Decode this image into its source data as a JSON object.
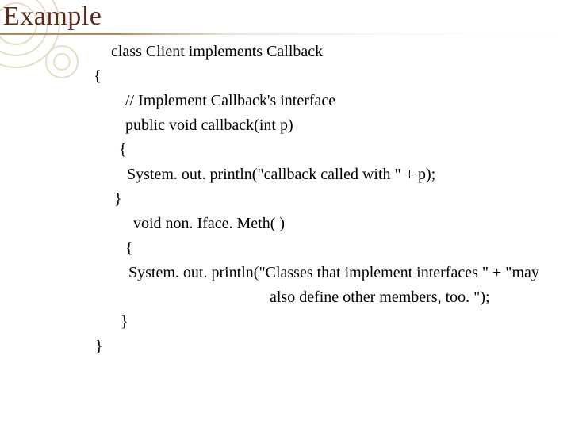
{
  "title": "Example",
  "code": {
    "l1": "class Client implements Callback",
    "l2": "{",
    "l3": "// Implement Callback's interface",
    "l4": "public void callback(int p)",
    "l5": "{",
    "l6": "System. out. println(\"callback called with \" + p);",
    "l7": "}",
    "l8": "void non. Iface. Meth( )",
    "l9": "{",
    "l10": "System. out. println(\"Classes that implement interfaces \" + \"may",
    "l11": "also define other members, too. \");",
    "l12": "}",
    "l13": "}"
  }
}
